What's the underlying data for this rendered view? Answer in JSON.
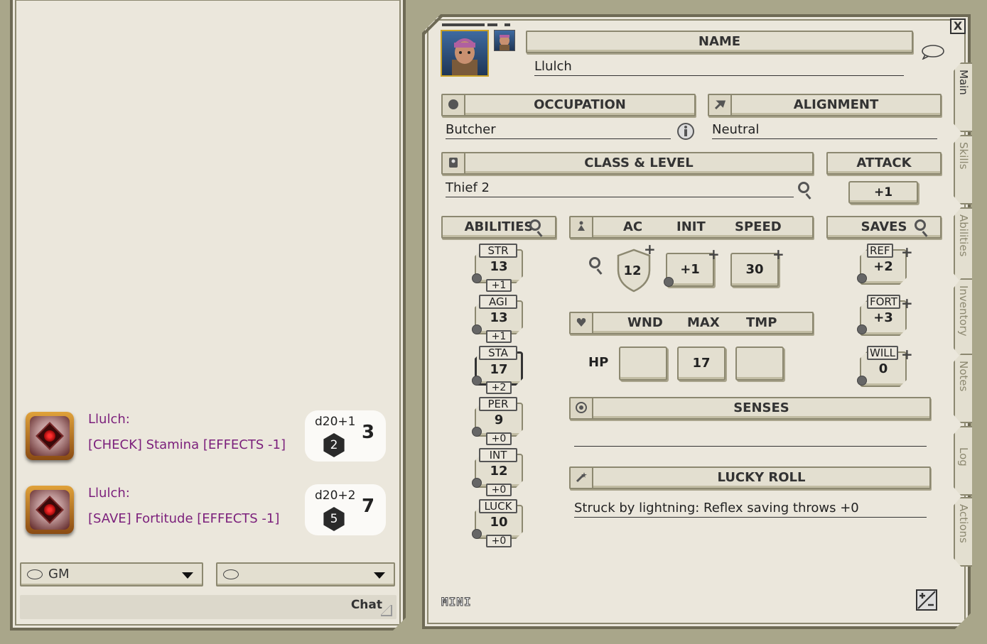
{
  "chat": {
    "messages": [
      {
        "speaker": "Llulch:",
        "text": "[CHECK] Stamina [EFFECTS -1]",
        "formula": "d20+1",
        "die": "2",
        "total": "3"
      },
      {
        "speaker": "Llulch:",
        "text": "[SAVE] Fortitude [EFFECTS -1]",
        "formula": "d20+2",
        "die": "5",
        "total": "7"
      }
    ],
    "identity_select": "GM",
    "language_select": "",
    "entry_label": "Chat"
  },
  "sheet": {
    "close_label": "X",
    "name_header": "NAME",
    "name_value": "Llulch",
    "occupation_header": "OCCUPATION",
    "occupation_value": "Butcher",
    "alignment_header": "ALIGNMENT",
    "alignment_value": "Neutral",
    "class_header": "CLASS & LEVEL",
    "class_value": "Thief 2",
    "attack_header": "ATTACK",
    "attack_value": "+1",
    "abilities_header": "ABILITIES",
    "abilities": [
      {
        "abbr": "STR",
        "score": "13",
        "mod": "+1"
      },
      {
        "abbr": "AGI",
        "score": "13",
        "mod": "+1"
      },
      {
        "abbr": "STA",
        "score": "17",
        "mod": "+2"
      },
      {
        "abbr": "PER",
        "score": "9",
        "mod": "+0"
      },
      {
        "abbr": "INT",
        "score": "12",
        "mod": "+0"
      },
      {
        "abbr": "LUCK",
        "score": "10",
        "mod": "+0"
      }
    ],
    "defense": {
      "ac_label": "AC",
      "init_label": "INIT",
      "speed_label": "SPEED",
      "ac": "12",
      "init": "+1",
      "speed": "30"
    },
    "hp": {
      "wnd_label": "WND",
      "max_label": "MAX",
      "tmp_label": "TMP",
      "hp_label": "HP",
      "wnd": "",
      "max": "17",
      "tmp": ""
    },
    "saves_header": "SAVES",
    "saves": [
      {
        "abbr": "REF",
        "value": "+2"
      },
      {
        "abbr": "FORT",
        "value": "+3"
      },
      {
        "abbr": "WILL",
        "value": "0"
      }
    ],
    "senses_header": "SENSES",
    "senses_value": "",
    "lucky_header": "LUCKY ROLL",
    "lucky_value": "Struck by lightning: Reflex saving throws +0",
    "mini_label": "MINI",
    "tabs": [
      "Main",
      "Skills",
      "Abilities",
      "Inventory",
      "Notes",
      "Log",
      "Actions"
    ]
  },
  "colors": {
    "chat_text": "#7b1f7b",
    "panel_bg": "#ebe7dc",
    "frame": "#6e6a55",
    "desktop": "#a9a68a"
  }
}
